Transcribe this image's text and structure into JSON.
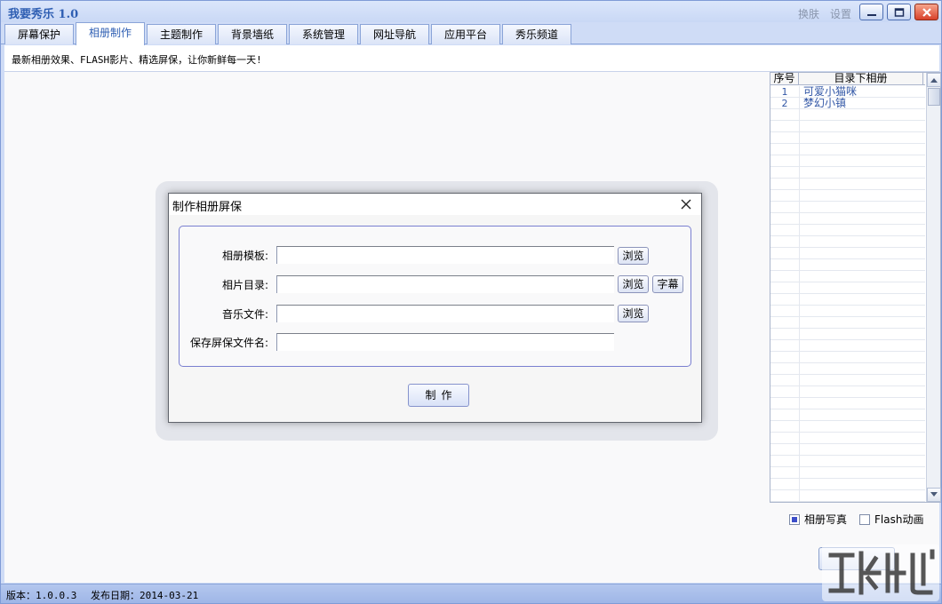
{
  "window": {
    "title": "我要秀乐 1.0",
    "skin_label": "换肤",
    "settings_label": "设置"
  },
  "tabs": [
    {
      "label": "屏幕保护"
    },
    {
      "label": "相册制作",
      "active": true
    },
    {
      "label": "主题制作"
    },
    {
      "label": "背景墙纸"
    },
    {
      "label": "系统管理"
    },
    {
      "label": "网址导航"
    },
    {
      "label": "应用平台"
    },
    {
      "label": "秀乐频道"
    }
  ],
  "slogan": "最新相册效果、FLASH影片、精选屏保，让你新鲜每一天!",
  "album_list": {
    "headers": {
      "no": "序号",
      "name": "目录下相册"
    },
    "rows": [
      {
        "no": "1",
        "name": "可爱小猫咪"
      },
      {
        "no": "2",
        "name": "梦幻小镇"
      }
    ]
  },
  "options": {
    "photo_album": {
      "label": "相册写真",
      "checked": true
    },
    "flash_animation": {
      "label": "Flash动画",
      "checked": false
    }
  },
  "status": {
    "version": "版本：1.0.0.3",
    "release_date": "发布日期：2014-03-21"
  },
  "dialog": {
    "title": "制作相册屏保",
    "fields": {
      "template": {
        "label": "相册模板:",
        "value": "",
        "browse_label": "浏览"
      },
      "photo_dir": {
        "label": "相片目录:",
        "value": "",
        "browse_label": "浏览",
        "subtitle_label": "字幕"
      },
      "music": {
        "label": "音乐文件:",
        "value": "",
        "browse_label": "浏览"
      },
      "save_name": {
        "label": "保存屏保文件名:",
        "value": ""
      }
    },
    "make_label": "制作"
  },
  "colors": {
    "accent": "#2f5fb3",
    "window_bg": "#cfdcf6",
    "status_bar": "#a9bfea",
    "close_button": "#d8412a"
  }
}
